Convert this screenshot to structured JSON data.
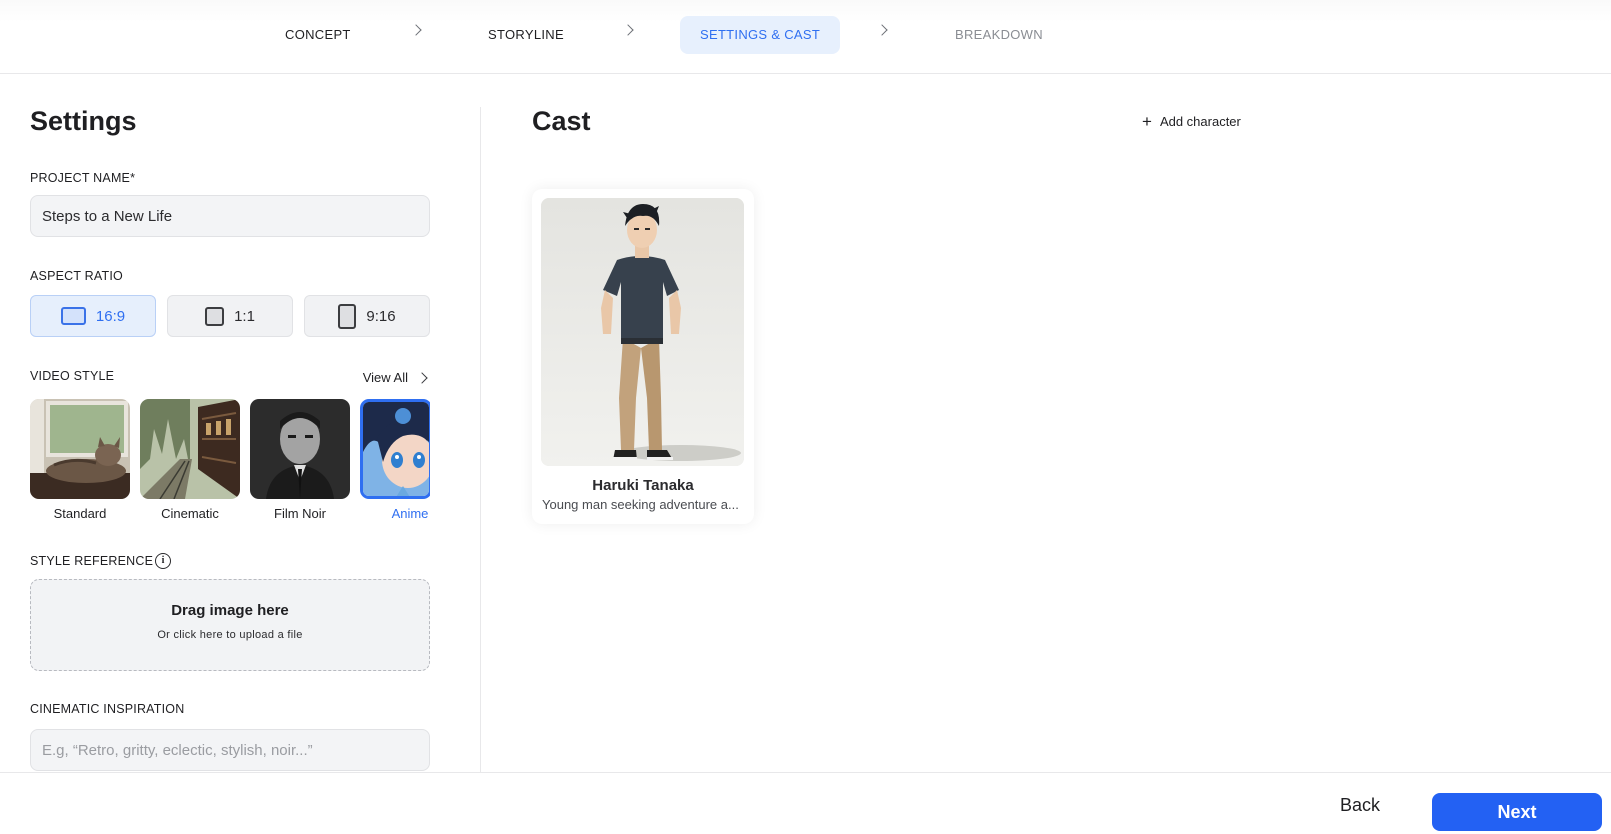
{
  "stepper": {
    "steps": [
      {
        "label": "CONCEPT",
        "state": "done"
      },
      {
        "label": "STORYLINE",
        "state": "done"
      },
      {
        "label": "SETTINGS & CAST",
        "state": "active"
      },
      {
        "label": "BREAKDOWN",
        "state": "upcoming"
      }
    ]
  },
  "settings": {
    "title": "Settings",
    "project_name": {
      "label": "PROJECT NAME*",
      "value": "Steps to a New Life"
    },
    "aspect_ratio": {
      "label": "ASPECT RATIO",
      "options": [
        {
          "label": "16:9",
          "icon": "landscape-rect-icon",
          "selected": true
        },
        {
          "label": "1:1",
          "icon": "square-icon",
          "selected": false
        },
        {
          "label": "9:16",
          "icon": "portrait-rect-icon",
          "selected": false
        }
      ]
    },
    "video_style": {
      "label": "VIDEO STYLE",
      "view_all": "View All",
      "options": [
        {
          "label": "Standard",
          "selected": false
        },
        {
          "label": "Cinematic",
          "selected": false
        },
        {
          "label": "Film Noir",
          "selected": false
        },
        {
          "label": "Anime",
          "selected": true
        }
      ]
    },
    "style_reference": {
      "label": "STYLE REFERENCE",
      "dropzone_title": "Drag image here",
      "dropzone_subtitle": "Or click here to upload a file"
    },
    "cinematic_inspiration": {
      "label": "CINEMATIC INSPIRATION",
      "placeholder": "E.g, “Retro, gritty, eclectic, stylish, noir...”",
      "value": ""
    }
  },
  "cast": {
    "title": "Cast",
    "add_label": "Add character",
    "characters": [
      {
        "name": "Haruki Tanaka",
        "description": "Young man seeking adventure a..."
      }
    ]
  },
  "footer": {
    "back": "Back",
    "next": "Next"
  },
  "colors": {
    "accent": "#2f6ff1",
    "primary_button": "#2361f3",
    "active_step_bg": "#e7f0fd"
  }
}
